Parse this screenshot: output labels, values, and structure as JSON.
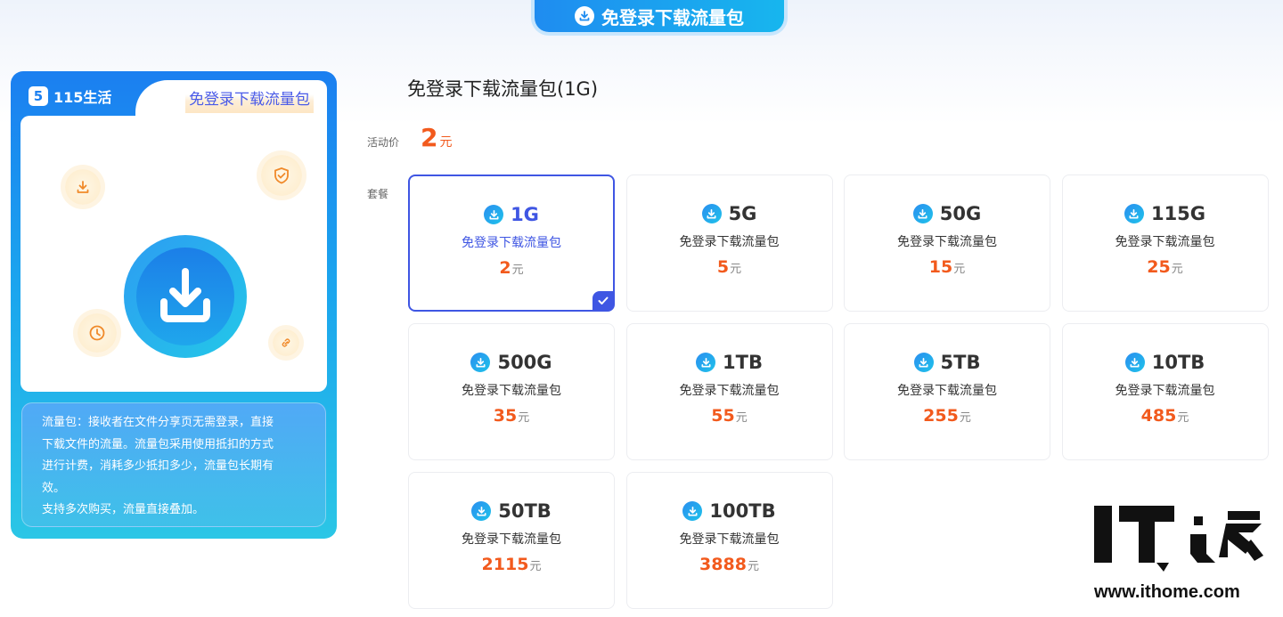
{
  "top_tab": {
    "label": "免登录下载流量包"
  },
  "left_card": {
    "brand_name": "115生活",
    "brand_logo_letter": "5",
    "panel_badge": "免登录下载流量包",
    "description_lines": [
      "流量包：接收者在文件分享页无需登录，直接",
      "下载文件的流量。流量包采用使用抵扣的方式",
      "进行计费，消耗多少抵扣多少，流量包长期有",
      "效。",
      "支持多次购买，流量直接叠加。"
    ]
  },
  "main": {
    "title": "免登录下载流量包(1G)",
    "price_label": "活动价",
    "price_value": "2",
    "price_unit": "元",
    "package_label": "套餐"
  },
  "packages": [
    {
      "size": "1G",
      "desc": "免登录下载流量包",
      "price": "2",
      "unit": "元",
      "selected": true
    },
    {
      "size": "5G",
      "desc": "免登录下载流量包",
      "price": "5",
      "unit": "元"
    },
    {
      "size": "50G",
      "desc": "免登录下载流量包",
      "price": "15",
      "unit": "元"
    },
    {
      "size": "115G",
      "desc": "免登录下载流量包",
      "price": "25",
      "unit": "元"
    },
    {
      "size": "500G",
      "desc": "免登录下载流量包",
      "price": "35",
      "unit": "元"
    },
    {
      "size": "1TB",
      "desc": "免登录下载流量包",
      "price": "55",
      "unit": "元"
    },
    {
      "size": "5TB",
      "desc": "免登录下载流量包",
      "price": "255",
      "unit": "元"
    },
    {
      "size": "10TB",
      "desc": "免登录下载流量包",
      "price": "485",
      "unit": "元"
    },
    {
      "size": "50TB",
      "desc": "免登录下载流量包",
      "price": "2115",
      "unit": "元"
    },
    {
      "size": "100TB",
      "desc": "免登录下载流量包",
      "price": "3888",
      "unit": "元"
    }
  ],
  "watermark": {
    "logo_text": "IT之家",
    "url": "www.ithome.com"
  },
  "colors": {
    "accent": "#3f56e3",
    "price": "#f25a1d",
    "brand_blue": "#1b7ff0"
  }
}
